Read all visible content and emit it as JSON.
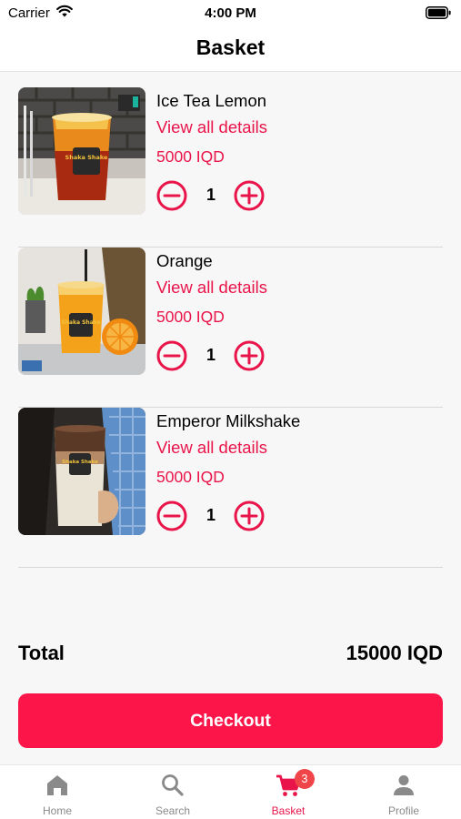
{
  "status_bar": {
    "carrier": "Carrier",
    "time": "4:00 PM"
  },
  "header": {
    "title": "Basket"
  },
  "items": [
    {
      "name": "Ice Tea Lemon",
      "link": "View all details",
      "price": "5000 IQD",
      "quantity": "1",
      "cup_label": "Shaka Shake"
    },
    {
      "name": "Orange",
      "link": "View all details",
      "price": "5000 IQD",
      "quantity": "1",
      "cup_label": "Shaka Shake"
    },
    {
      "name": "Emperor Milkshake",
      "link": "View all details",
      "price": "5000 IQD",
      "quantity": "1",
      "cup_label": "Shaka Shake"
    }
  ],
  "summary": {
    "total_label": "Total",
    "total_value": "15000 IQD"
  },
  "checkout": {
    "label": "Checkout"
  },
  "tabs": [
    {
      "label": "Home",
      "icon": "home-icon"
    },
    {
      "label": "Search",
      "icon": "search-icon"
    },
    {
      "label": "Basket",
      "icon": "cart-icon",
      "badge": "3",
      "active": true
    },
    {
      "label": "Profile",
      "icon": "person-icon"
    }
  ],
  "colors": {
    "accent": "#e8144a",
    "checkout": "#fb1548",
    "badge": "#f0464a"
  }
}
